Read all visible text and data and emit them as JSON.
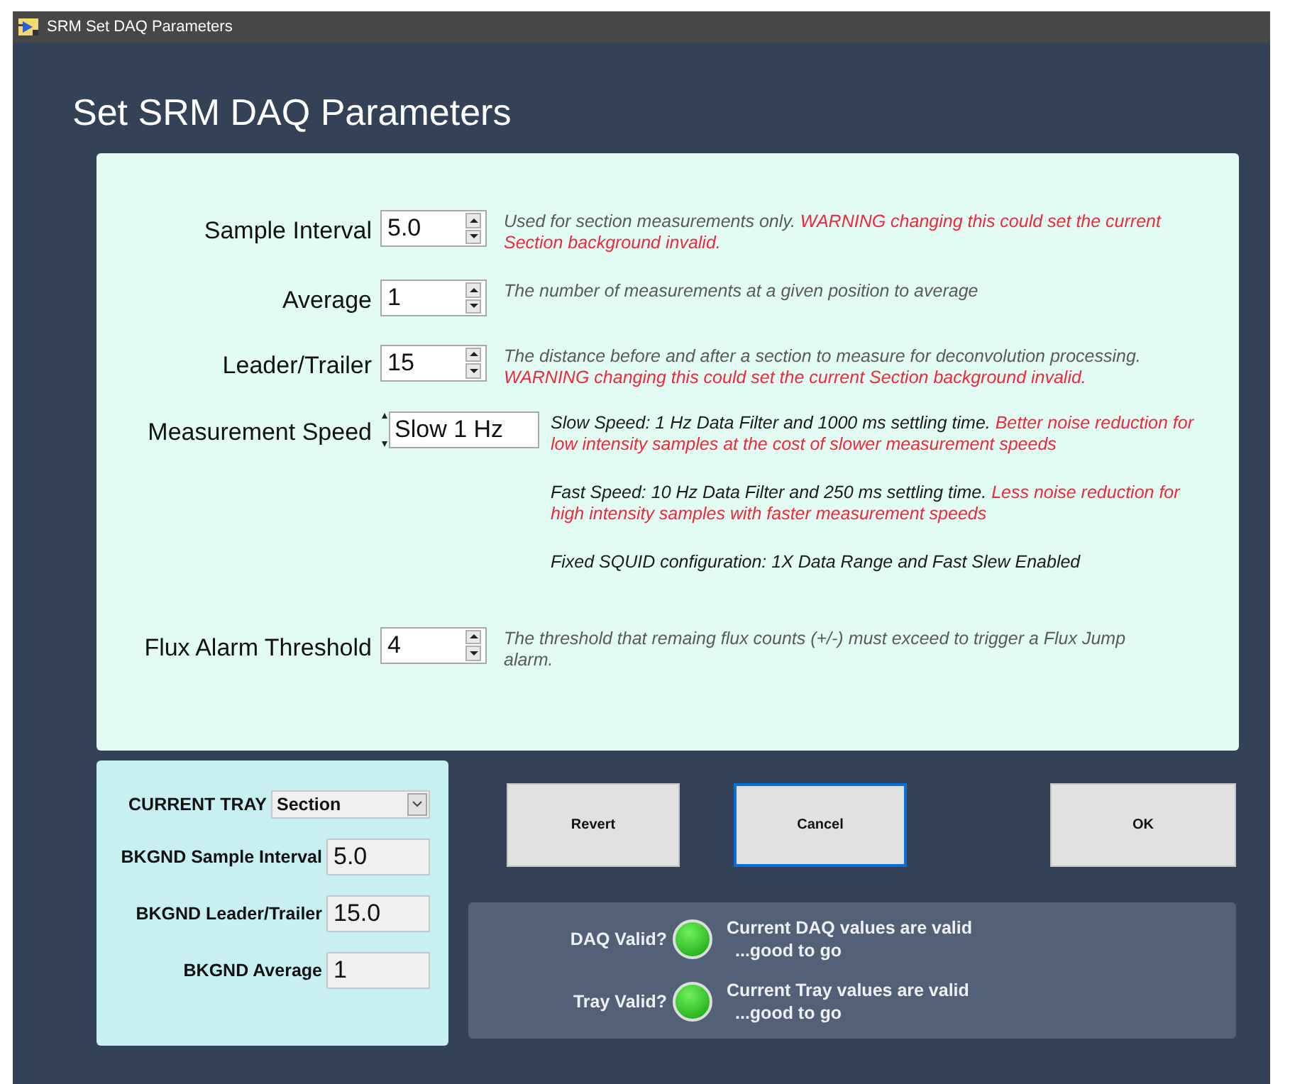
{
  "window": {
    "title": "SRM Set DAQ Parameters"
  },
  "heading": "Set SRM DAQ Parameters",
  "parameters": [
    {
      "kind": "numeric",
      "label": "Sample Interval",
      "value": "5.0",
      "notes": [
        [
          {
            "text": "Used for section measurements only. ",
            "kind": "info"
          },
          {
            "text": "WARNING changing this could set the current Section background invalid.",
            "kind": "warning"
          }
        ]
      ]
    },
    {
      "kind": "numeric",
      "label": "Average",
      "value": "1",
      "notes": [
        [
          {
            "text": "The number of measurements at a given position to average",
            "kind": "info"
          }
        ]
      ]
    },
    {
      "kind": "numeric",
      "label": "Leader/Trailer",
      "value": "15",
      "notes": [
        [
          {
            "text": "The distance before and after a section to measure for deconvolution processing. ",
            "kind": "info"
          },
          {
            "text": "WARNING changing this could set the current Section background invalid.",
            "kind": "warning"
          }
        ]
      ]
    },
    {
      "kind": "ring",
      "label": "Measurement Speed",
      "value": "Slow 1 Hz",
      "notes": [
        [
          {
            "text": "Slow Speed:  1 Hz Data Filter and 1000 ms settling time. ",
            "kind": "plain"
          },
          {
            "text": "Better noise reduction for low intensity samples at the cost of slower measurement speeds",
            "kind": "warning"
          }
        ],
        [
          {
            "text": "Fast Speed: 10 Hz Data Filter and 250 ms settling time. ",
            "kind": "plain"
          },
          {
            "text": "Less noise reduction for high intensity samples with faster measurement speeds",
            "kind": "warning"
          }
        ],
        [
          {
            "text": "Fixed SQUID configuration:  1X Data Range and Fast Slew Enabled",
            "kind": "plain"
          }
        ]
      ]
    },
    {
      "kind": "numeric",
      "label": "Flux Alarm Threshold",
      "value": "4",
      "notes": [
        [
          {
            "text": "The threshold that remaing flux counts (+/-) must exceed to trigger a Flux Jump alarm.",
            "kind": "info"
          }
        ]
      ]
    }
  ],
  "tray": {
    "label": "CURRENT TRAY",
    "value": "Section"
  },
  "background": [
    {
      "label": "BKGND Sample Interval",
      "value": "5.0"
    },
    {
      "label": "BKGND Leader/Trailer",
      "value": "15.0"
    },
    {
      "label": "BKGND Average",
      "value": "1"
    }
  ],
  "buttons": [
    {
      "label": "Revert",
      "focused": false
    },
    {
      "label": "Cancel",
      "focused": true
    },
    {
      "label": "OK",
      "focused": false
    }
  ],
  "status": [
    {
      "label": "DAQ Valid?",
      "lit": true,
      "message": "Current DAQ values are valid",
      "detail": "...good to go"
    },
    {
      "label": "Tray Valid?",
      "lit": true,
      "message": "Current Tray values are valid",
      "detail": "...good to go"
    }
  ]
}
